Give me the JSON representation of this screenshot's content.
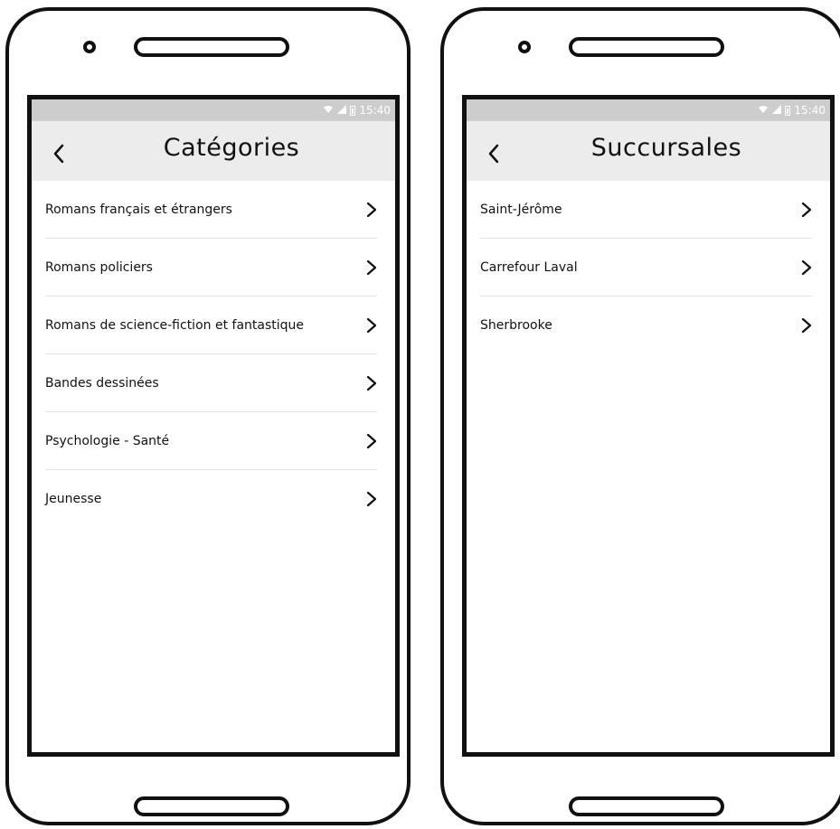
{
  "statusbar": {
    "time": "15:40"
  },
  "categories_screen": {
    "title": "Catégories",
    "items": [
      "Romans français et étrangers",
      "Romans policiers",
      "Romans de science-fiction et fantastique",
      "Bandes dessinées",
      "Psychologie - Santé",
      "Jeunesse"
    ]
  },
  "branches_screen": {
    "title": "Succursales",
    "items": [
      "Saint-Jérôme",
      "Carrefour Laval",
      "Sherbrooke"
    ]
  },
  "icons": [
    "back-arrow-icon",
    "chevron-right-icon",
    "wifi-icon",
    "signal-icon",
    "battery-icon"
  ]
}
